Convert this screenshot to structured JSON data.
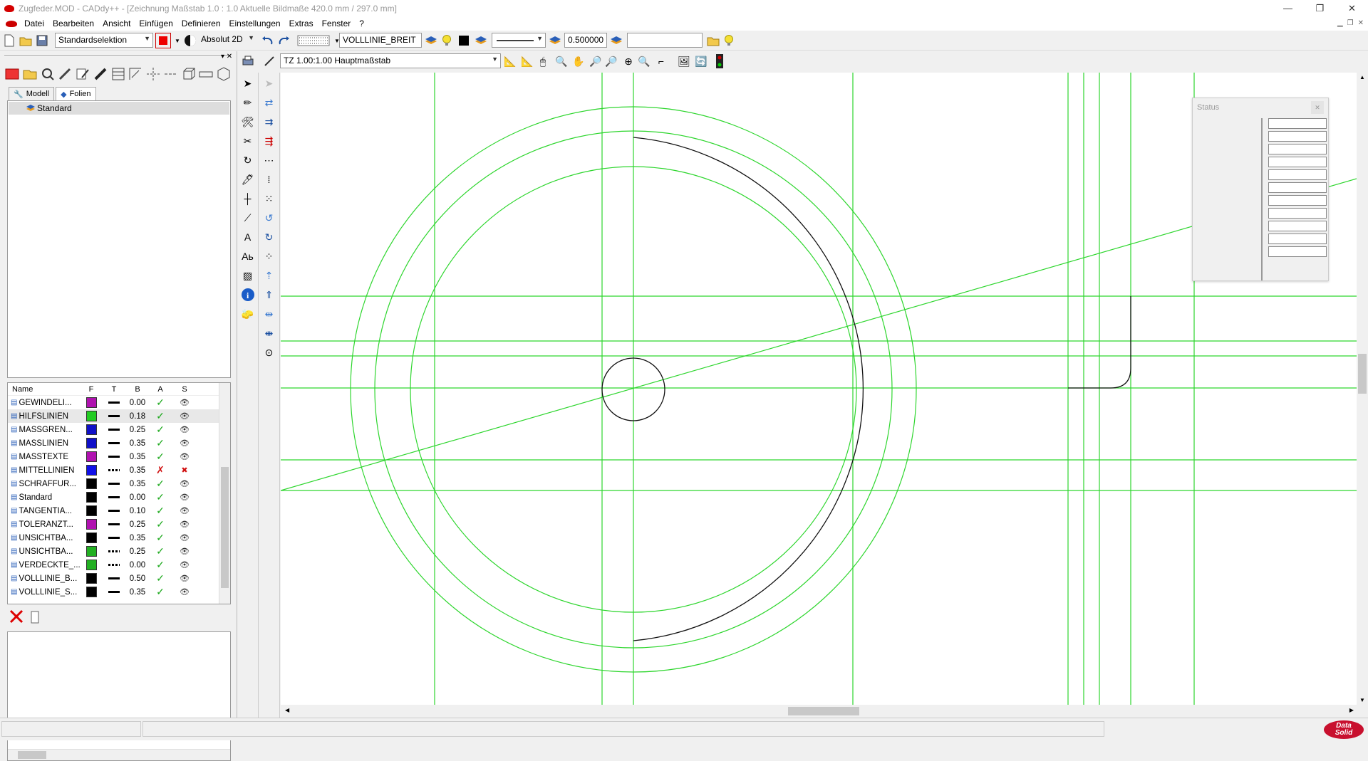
{
  "window": {
    "title": "Zugfeder.MOD  -  CADdy++ - [Zeichnung   Maßstab 1.0 : 1.0   Aktuelle Bildmaße 420.0 mm / 297.0 mm]",
    "minimize": "—",
    "restore": "❐",
    "close": "✕"
  },
  "menu": {
    "items": [
      "Datei",
      "Bearbeiten",
      "Ansicht",
      "Einfügen",
      "Definieren",
      "Einstellungen",
      "Extras",
      "Fenster",
      "?"
    ]
  },
  "toolbar": {
    "selection_mode": "Standardselektion",
    "coord_mode": "Absolut 2D",
    "layer_name": "VOLLLINIE_BREIT",
    "line_width": "0.500000",
    "search_value": ""
  },
  "view_toolbar": {
    "scale_label": "TZ 1.00:1.00 Hauptmaßstab"
  },
  "left_panel": {
    "tabs": [
      "Modell",
      "Folien"
    ],
    "active_tab": "Folien",
    "tree": [
      {
        "label": "Standard"
      }
    ],
    "layer_headers": {
      "name": "Name",
      "f": "F",
      "t": "T",
      "b": "B",
      "a": "A",
      "s": "S"
    },
    "layers": [
      {
        "name": "GEWINDELI...",
        "color": "#b012b0",
        "line": "solid",
        "width": "0.00",
        "active": true,
        "visible": true
      },
      {
        "name": "HILFSLINIEN",
        "color": "#22cc22",
        "line": "solid",
        "width": "0.18",
        "active": true,
        "visible": true
      },
      {
        "name": "MASSGREN...",
        "color": "#1010c8",
        "line": "solid",
        "width": "0.25",
        "active": true,
        "visible": true
      },
      {
        "name": "MASSLINIEN",
        "color": "#1010c8",
        "line": "solid",
        "width": "0.35",
        "active": true,
        "visible": true
      },
      {
        "name": "MASSTEXTE",
        "color": "#b012b0",
        "line": "solid",
        "width": "0.35",
        "active": true,
        "visible": true
      },
      {
        "name": "MITTELLINIEN",
        "color": "#1010e8",
        "line": "dotted",
        "width": "0.35",
        "active": false,
        "visible": false
      },
      {
        "name": "SCHRAFFUR...",
        "color": "#000000",
        "line": "solid",
        "width": "0.35",
        "active": true,
        "visible": true
      },
      {
        "name": "Standard",
        "color": "#000000",
        "line": "solid",
        "width": "0.00",
        "active": true,
        "visible": true
      },
      {
        "name": "TANGENTIA...",
        "color": "#000000",
        "line": "solid",
        "width": "0.10",
        "active": true,
        "visible": true
      },
      {
        "name": "TOLERANZT...",
        "color": "#b012b0",
        "line": "solid",
        "width": "0.25",
        "active": true,
        "visible": true
      },
      {
        "name": "UNSICHTBA...",
        "color": "#000000",
        "line": "solid",
        "width": "0.35",
        "active": true,
        "visible": true
      },
      {
        "name": "UNSICHTBA...",
        "color": "#22b022",
        "line": "dotted",
        "width": "0.25",
        "active": true,
        "visible": true
      },
      {
        "name": "VERDECKTE_...",
        "color": "#22b022",
        "line": "dotted",
        "width": "0.00",
        "active": true,
        "visible": true
      },
      {
        "name": "VOLLLINIE_B...",
        "color": "#000000",
        "line": "solid",
        "width": "0.50",
        "active": true,
        "visible": true
      },
      {
        "name": "VOLLLINIE_S...",
        "color": "#000000",
        "line": "solid",
        "width": "0.35",
        "active": true,
        "visible": true
      }
    ]
  },
  "status_dialog": {
    "title": "Status",
    "close": "✕"
  },
  "branding": {
    "logo_line1": "Data",
    "logo_line2": "Solid"
  }
}
